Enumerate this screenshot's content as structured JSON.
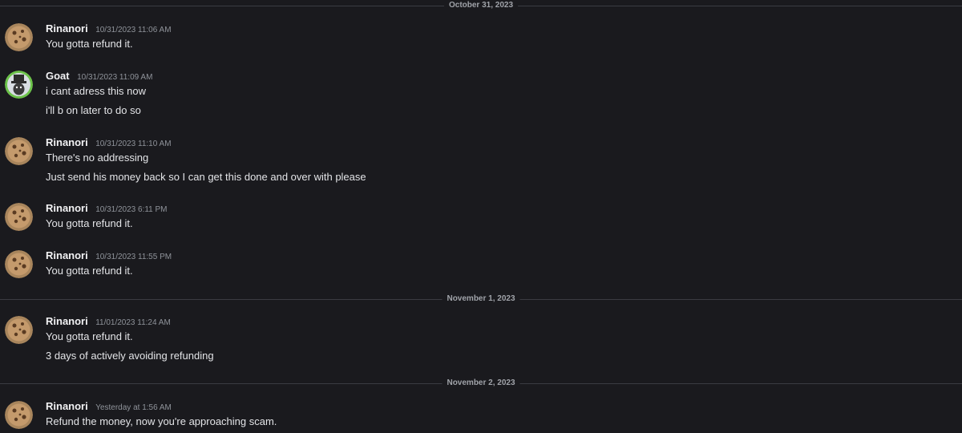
{
  "dividers": [
    {
      "label": "October 31, 2023"
    },
    {
      "label": "November 1, 2023"
    },
    {
      "label": "November 2, 2023"
    }
  ],
  "messages": [
    {
      "author": "Rinanori",
      "avatar_icon": "cookie-avatar-icon",
      "timestamp": "10/31/2023 11:06 AM",
      "lines": [
        "You gotta refund it."
      ]
    },
    {
      "author": "Goat",
      "avatar_icon": "goat-avatar-icon",
      "timestamp": "10/31/2023 11:09 AM",
      "lines": [
        "i cant adress this now",
        "i'll b on later to do so"
      ]
    },
    {
      "author": "Rinanori",
      "avatar_icon": "cookie-avatar-icon",
      "timestamp": "10/31/2023 11:10 AM",
      "lines": [
        "There's no addressing",
        "Just send his money back so I can get this done and over with please"
      ]
    },
    {
      "author": "Rinanori",
      "avatar_icon": "cookie-avatar-icon",
      "timestamp": "10/31/2023 6:11 PM",
      "lines": [
        "You gotta refund it."
      ]
    },
    {
      "author": "Rinanori",
      "avatar_icon": "cookie-avatar-icon",
      "timestamp": "10/31/2023 11:55 PM",
      "lines": [
        "You gotta refund it."
      ]
    },
    {
      "author": "Rinanori",
      "avatar_icon": "cookie-avatar-icon",
      "timestamp": "11/01/2023 11:24 AM",
      "lines": [
        "You gotta refund it.",
        "3 days of actively avoiding refunding"
      ]
    },
    {
      "author": "Rinanori",
      "avatar_icon": "cookie-avatar-icon",
      "timestamp": "Yesterday at 1:56 AM",
      "lines": [
        "Refund the money, now you're approaching scam."
      ]
    }
  ],
  "colors": {
    "background": "#1a1a1e",
    "divider": "#3b3c42",
    "author": "#f1f1f3",
    "timestamp": "#8f939a",
    "text": "#e3e4e7"
  }
}
